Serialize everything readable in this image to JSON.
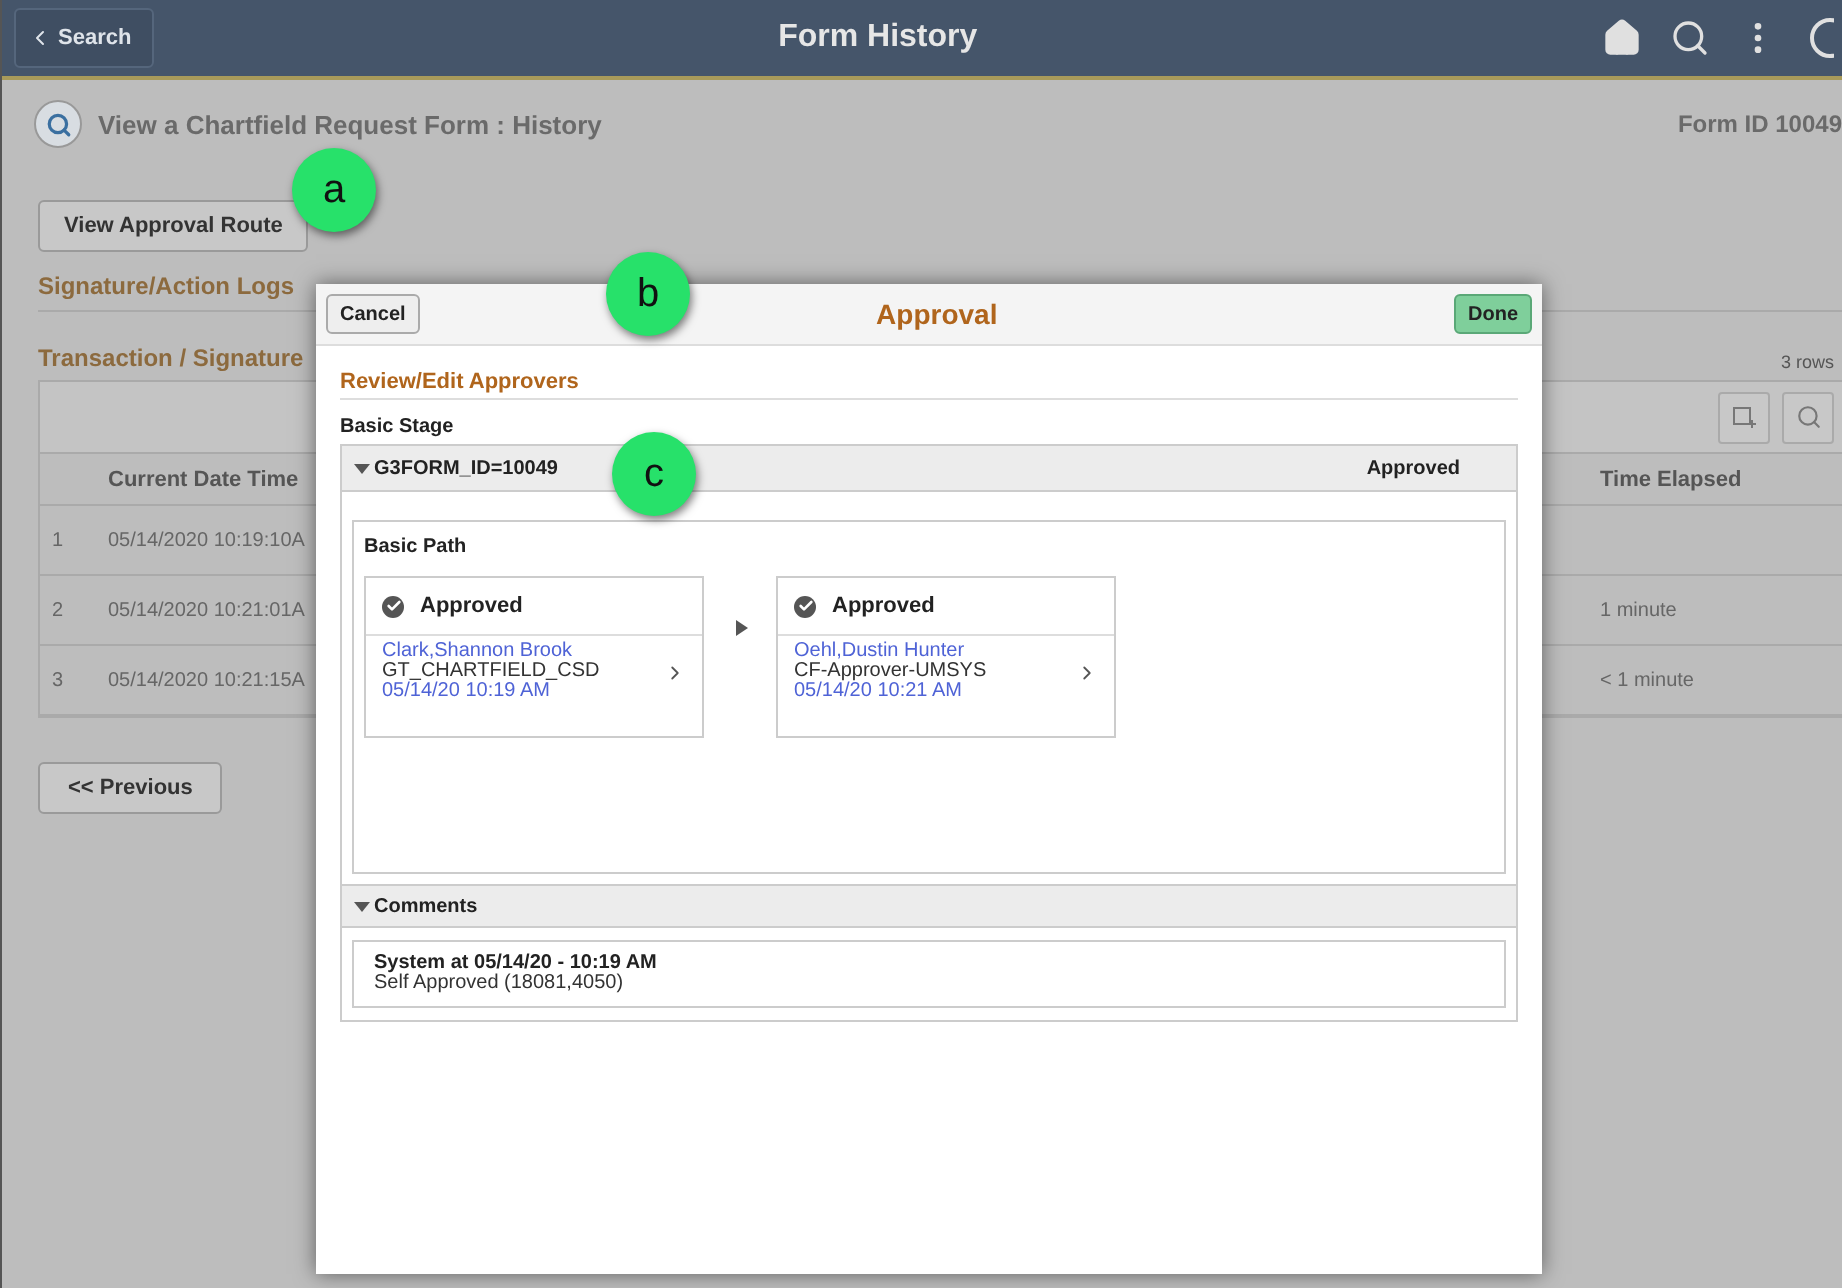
{
  "header": {
    "back_label": "Search",
    "title": "Form History"
  },
  "page": {
    "title": "View a Chartfield Request Form : History",
    "form_id": "Form ID 10049",
    "route_button": "View Approval Route",
    "section_title": "Signature/Action Logs",
    "grid_title": "Transaction / Signature",
    "row_count": "3 rows",
    "columns": [
      "Current Date Time",
      "Time Elapsed"
    ],
    "rows": [
      {
        "number": "1",
        "date_time": "05/14/2020 10:19:10A"
      },
      {
        "number": "2",
        "date_time": "05/14/2020 10:21:01A",
        "elapsed": "1 minute"
      },
      {
        "number": "3",
        "date_time": "05/14/2020 10:21:15A",
        "elapsed": "< 1 minute"
      }
    ],
    "previous_button": "<< Previous"
  },
  "dialog": {
    "cancel": "Cancel",
    "title": "Approval",
    "done": "Done",
    "section": "Review/Edit Approvers",
    "stage_label": "Basic Stage",
    "stage": {
      "name": "G3FORM_ID=10049",
      "status": "Approved",
      "expanded": true,
      "path_label": "Basic Path",
      "steps": [
        {
          "status": "Approved",
          "approver": "Clark,Shannon Brook",
          "role": "GT_CHARTFIELD_CSD",
          "date": "05/14/20 10:19 AM"
        },
        {
          "status": "Approved",
          "approver": "Oehl,Dustin Hunter",
          "role": "CF-Approver-UMSYS",
          "date": "05/14/20 10:21 AM"
        }
      ]
    },
    "comments": {
      "label": "Comments",
      "expanded": true,
      "items": [
        {
          "author_line": "System at 05/14/20 - 10:19 AM",
          "text": "Self Approved (18081,4050)"
        }
      ]
    }
  },
  "callouts": [
    "a",
    "b",
    "c"
  ]
}
